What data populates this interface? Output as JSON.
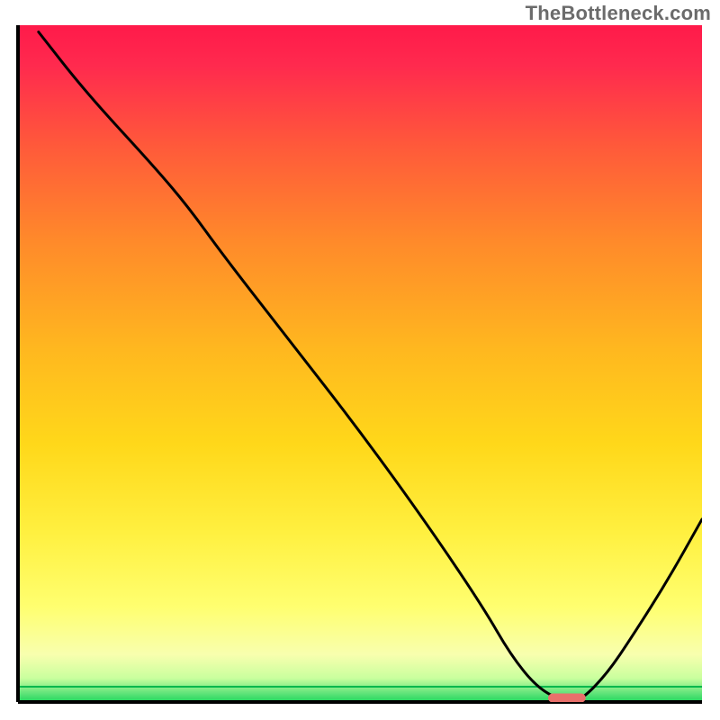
{
  "watermark": "TheBottleneck.com",
  "chart_data": {
    "type": "line",
    "title": "",
    "xlabel": "",
    "ylabel": "",
    "xlim": [
      0,
      100
    ],
    "ylim": [
      0,
      100
    ],
    "grid": false,
    "annotations": [],
    "series": [
      {
        "name": "curve",
        "x": [
          3,
          10,
          20,
          25,
          30,
          40,
          50,
          60,
          68,
          72,
          76,
          80,
          82,
          86,
          90,
          95,
          100
        ],
        "y": [
          99,
          90,
          79,
          73,
          66,
          53,
          40,
          26,
          14,
          7,
          2,
          0,
          0,
          4,
          10,
          18,
          27
        ]
      }
    ],
    "optimum_marker": {
      "x_start": 77.5,
      "x_end": 83,
      "y": 0.6,
      "color": "#e9706b"
    },
    "background_gradient": {
      "top": "#ff1a4a",
      "mid_upper": "#ff8a2a",
      "mid": "#ffd81a",
      "mid_lower": "#ffff66",
      "lower": "#f5ffb0",
      "bottom": "#1fd65c",
      "thin_line_y": 2.2,
      "thin_line_color": "#00b84d"
    },
    "axes_color": "#000000",
    "line_color": "#000000",
    "line_width": 2
  }
}
